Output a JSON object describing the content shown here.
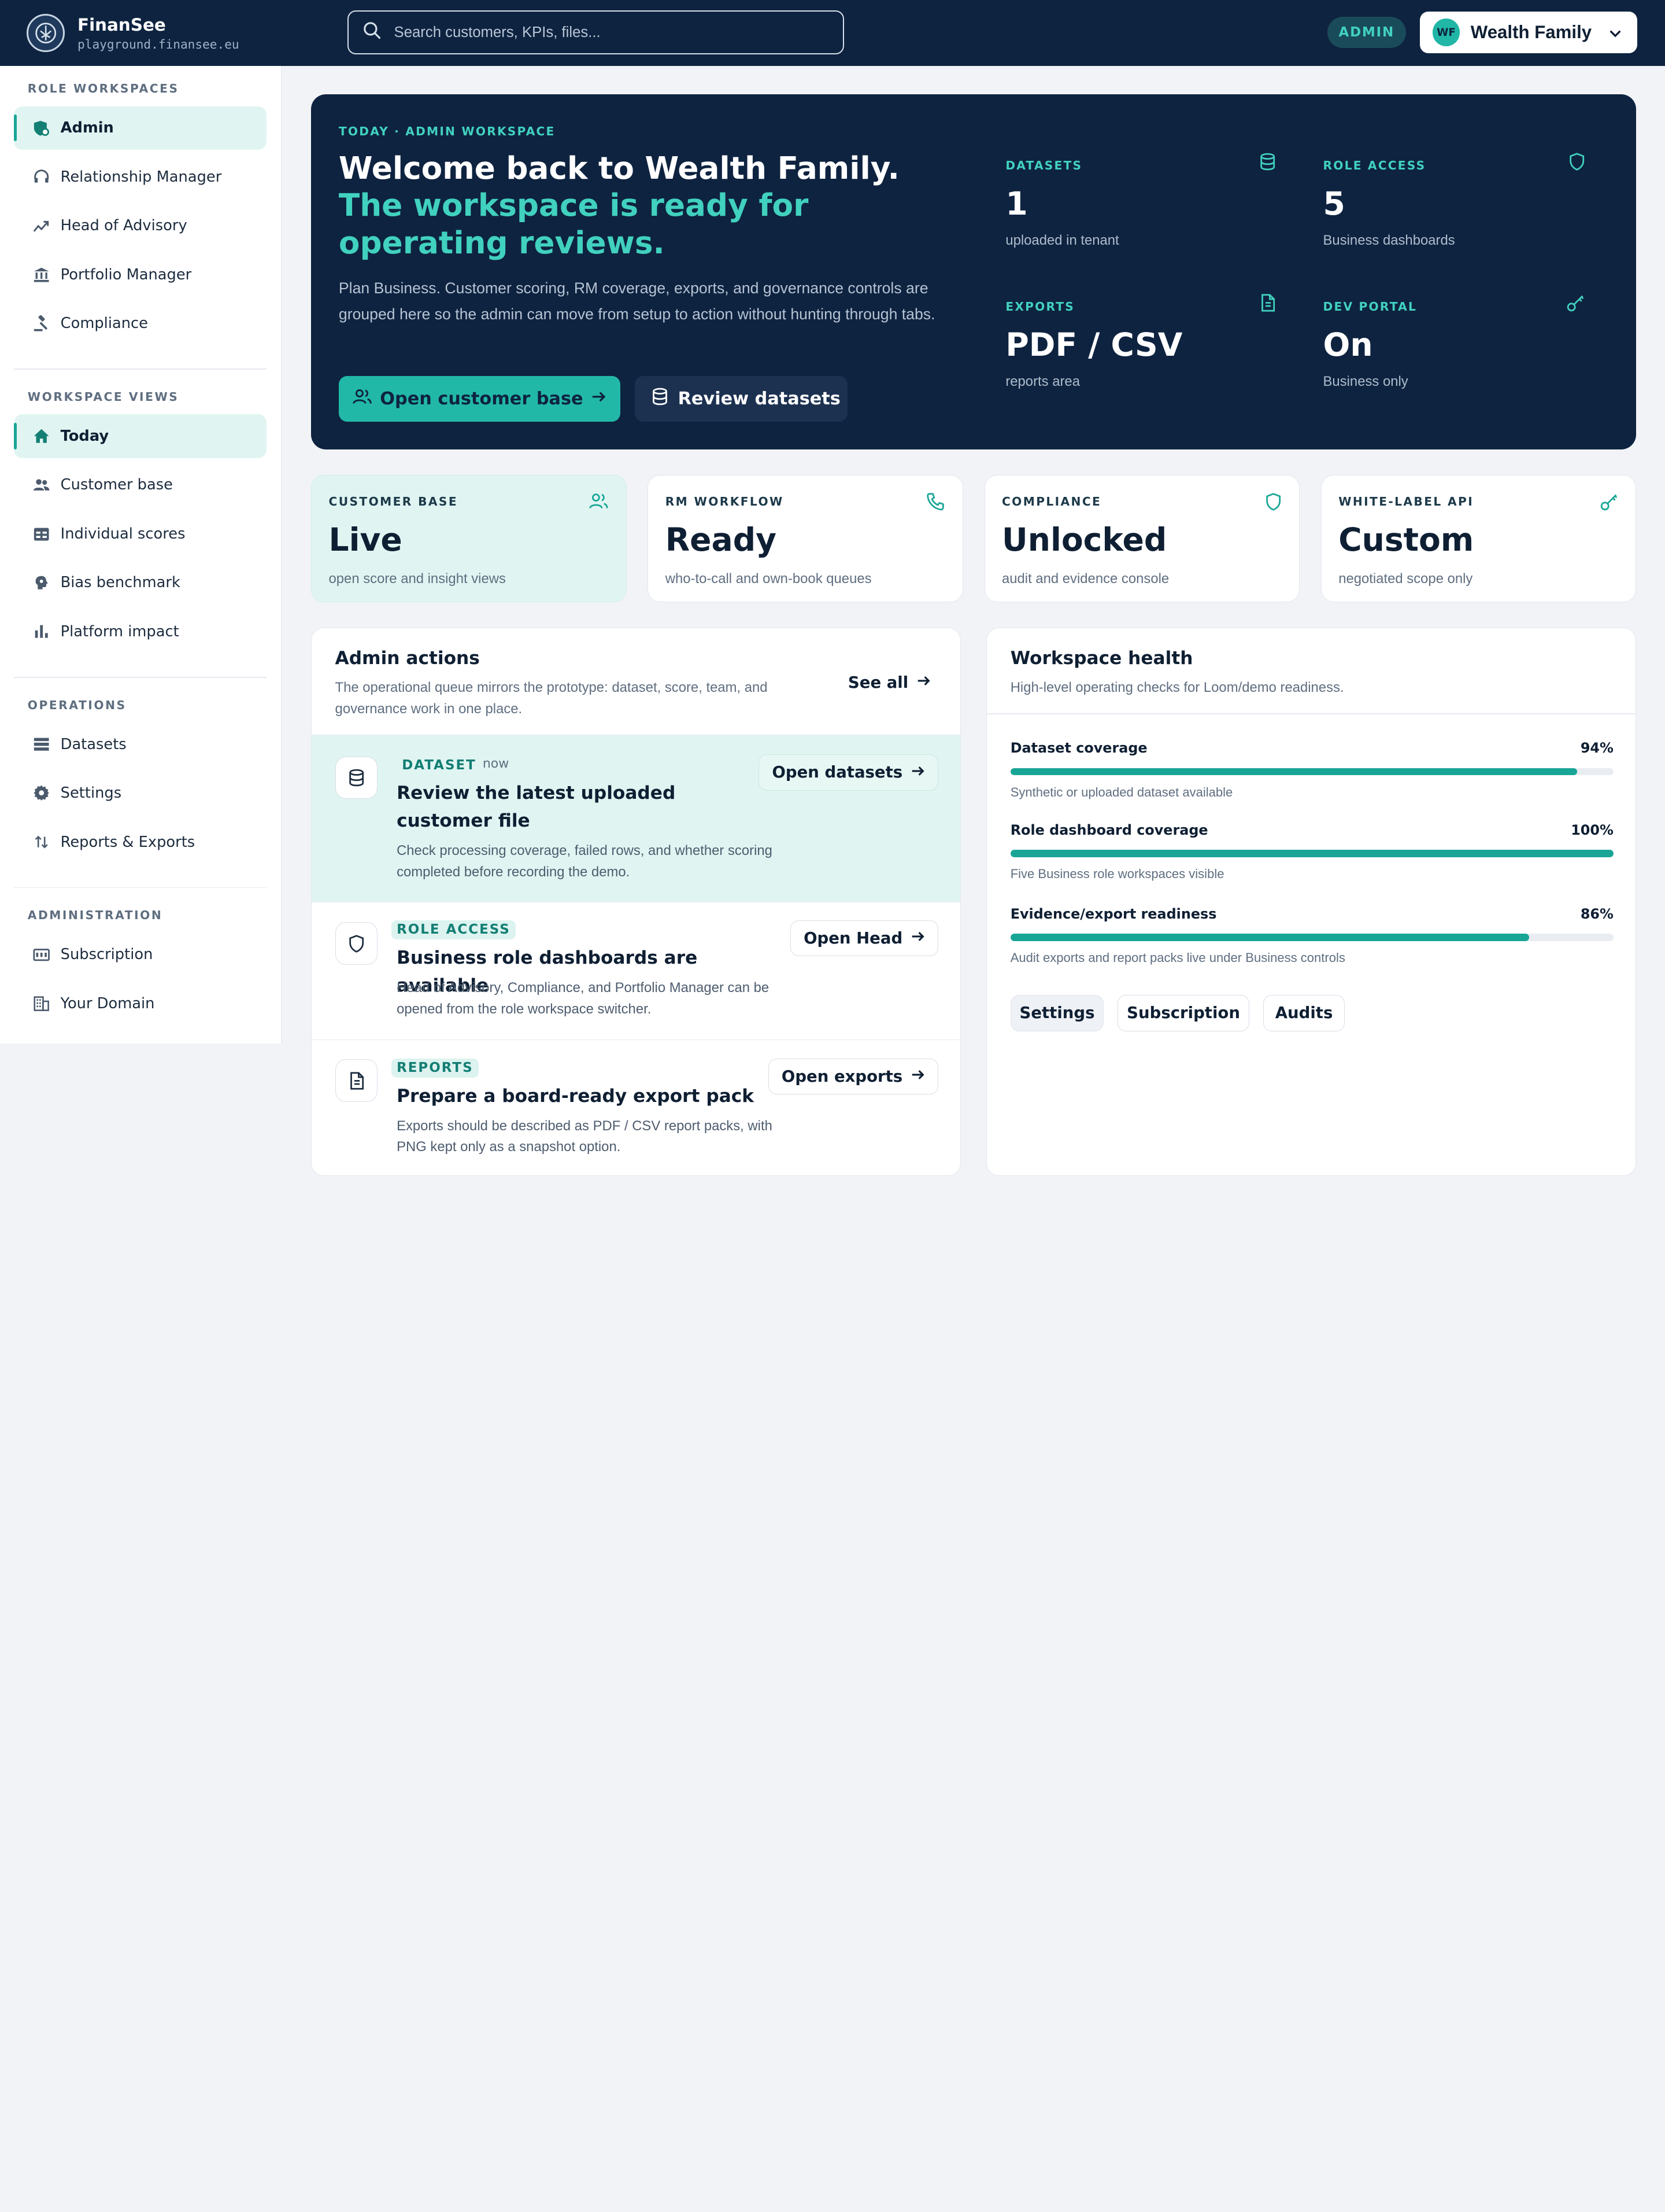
{
  "brand": {
    "name": "FinanSee",
    "domain": "playground.finansee.eu"
  },
  "search": {
    "placeholder": "Search customers, KPIs, files..."
  },
  "header": {
    "role_badge": "ADMIN",
    "tenant_initials": "WF",
    "tenant_name": "Wealth Family"
  },
  "sidebar": {
    "sections": [
      {
        "title": "ROLE WORKSPACES",
        "items": [
          "Admin",
          "Relationship Manager",
          "Head of Advisory",
          "Portfolio Manager",
          "Compliance"
        ]
      },
      {
        "title": "WORKSPACE VIEWS",
        "items": [
          "Today",
          "Customer base",
          "Individual scores",
          "Bias benchmark",
          "Platform impact"
        ]
      },
      {
        "title": "OPERATIONS",
        "items": [
          "Datasets",
          "Settings",
          "Reports & Exports"
        ]
      },
      {
        "title": "ADMINISTRATION",
        "items": [
          "Subscription",
          "Your Domain"
        ]
      }
    ]
  },
  "hero": {
    "eyebrow": "TODAY · ADMIN WORKSPACE",
    "title_main": "Welcome back to Wealth Family.",
    "title_accent": "The workspace is ready for operating reviews.",
    "description": "Plan Business. Customer scoring, RM coverage, exports, and governance controls are grouped here so the admin can move from setup to action without hunting through tabs.",
    "primary_button": "Open customer base",
    "secondary_button": "Review datasets",
    "stats": [
      {
        "label": "DATASETS",
        "value": "1",
        "sub": "uploaded in tenant",
        "icon": "database-icon"
      },
      {
        "label": "ROLE ACCESS",
        "value": "5",
        "sub": "Business dashboards",
        "icon": "shield-icon"
      },
      {
        "label": "EXPORTS",
        "value": "PDF / CSV",
        "sub": "reports area",
        "icon": "document-icon"
      },
      {
        "label": "DEV PORTAL",
        "value": "On",
        "sub": "Business only",
        "icon": "key-icon"
      }
    ]
  },
  "cards": [
    {
      "label": "CUSTOMER BASE",
      "value": "Live",
      "sub": "open score and insight views",
      "icon": "users-icon"
    },
    {
      "label": "RM WORKFLOW",
      "value": "Ready",
      "sub": "who-to-call and own-book queues",
      "icon": "phone-icon"
    },
    {
      "label": "COMPLIANCE",
      "value": "Unlocked",
      "sub": "audit and evidence console",
      "icon": "shield-icon"
    },
    {
      "label": "WHITE-LABEL API",
      "value": "Custom",
      "sub": "negotiated scope only",
      "icon": "key-icon"
    }
  ],
  "admin_actions": {
    "title": "Admin actions",
    "description": "The operational queue mirrors the prototype: dataset, score, team, and governance work in one place.",
    "see_all": "See all",
    "items": [
      {
        "tag": "DATASET",
        "time": "now",
        "title": "Review the latest uploaded customer file",
        "description": "Check processing coverage, failed rows, and whether scoring completed before recording the demo.",
        "button": "Open datasets"
      },
      {
        "tag": "ROLE ACCESS",
        "title": "Business role dashboards are available",
        "description": "Head of Advisory, Compliance, and Portfolio Manager can be opened from the role workspace switcher.",
        "button": "Open Head"
      },
      {
        "tag": "REPORTS",
        "title": "Prepare a board-ready export pack",
        "description": "Exports should be described as PDF / CSV report packs, with PNG kept only as a snapshot option.",
        "button": "Open exports"
      }
    ]
  },
  "health": {
    "title": "Workspace health",
    "description": "High-level operating checks for Loom/demo readiness.",
    "metrics": [
      {
        "name": "Dataset coverage",
        "percent_label": "94%",
        "value": 94,
        "sub": "Synthetic or uploaded dataset available"
      },
      {
        "name": "Role dashboard coverage",
        "percent_label": "100%",
        "value": 100,
        "sub": "Five Business role workspaces visible"
      },
      {
        "name": "Evidence/export readiness",
        "percent_label": "86%",
        "value": 86,
        "sub": "Audit exports and report packs live under Business controls"
      }
    ],
    "buttons": [
      "Settings",
      "Subscription",
      "Audits"
    ]
  },
  "colors": {
    "navy": "#0e2340",
    "accent": "#22b8a8",
    "accent_text": "#41d1bf",
    "tint": "#e0f5f2"
  }
}
